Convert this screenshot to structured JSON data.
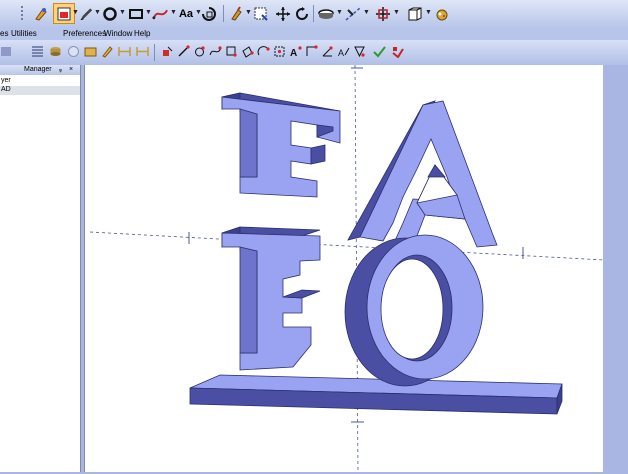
{
  "menu": {
    "items": [
      "es",
      "Utilities",
      "Preferences",
      "Window",
      "Help"
    ]
  },
  "toolbar_main": {
    "icons": [
      "snap-icon",
      "color-select-icon",
      "pen-icon",
      "circle-tool-icon",
      "rectangle-tool-icon",
      "curve-tool-icon",
      "text-tool-icon",
      "rotate-text-icon",
      "paint-icon",
      "select-box-icon",
      "move-icon",
      "orbit-icon",
      "extrude-icon",
      "mirror-icon",
      "grid-icon",
      "view-box-icon",
      "render-icon"
    ],
    "text_tool_label": "Aa"
  },
  "panel": {
    "title": "Manager",
    "pin": "ᵩ",
    "close": "×",
    "rows": [
      "yer",
      "AD"
    ]
  },
  "colors": {
    "toolbar_bg": "#c5d0ef",
    "app_bg": "#a9b6e3",
    "model_face": "#9aa2f2",
    "model_side": "#4a4fa3",
    "model_outline": "#2b2f6e"
  }
}
